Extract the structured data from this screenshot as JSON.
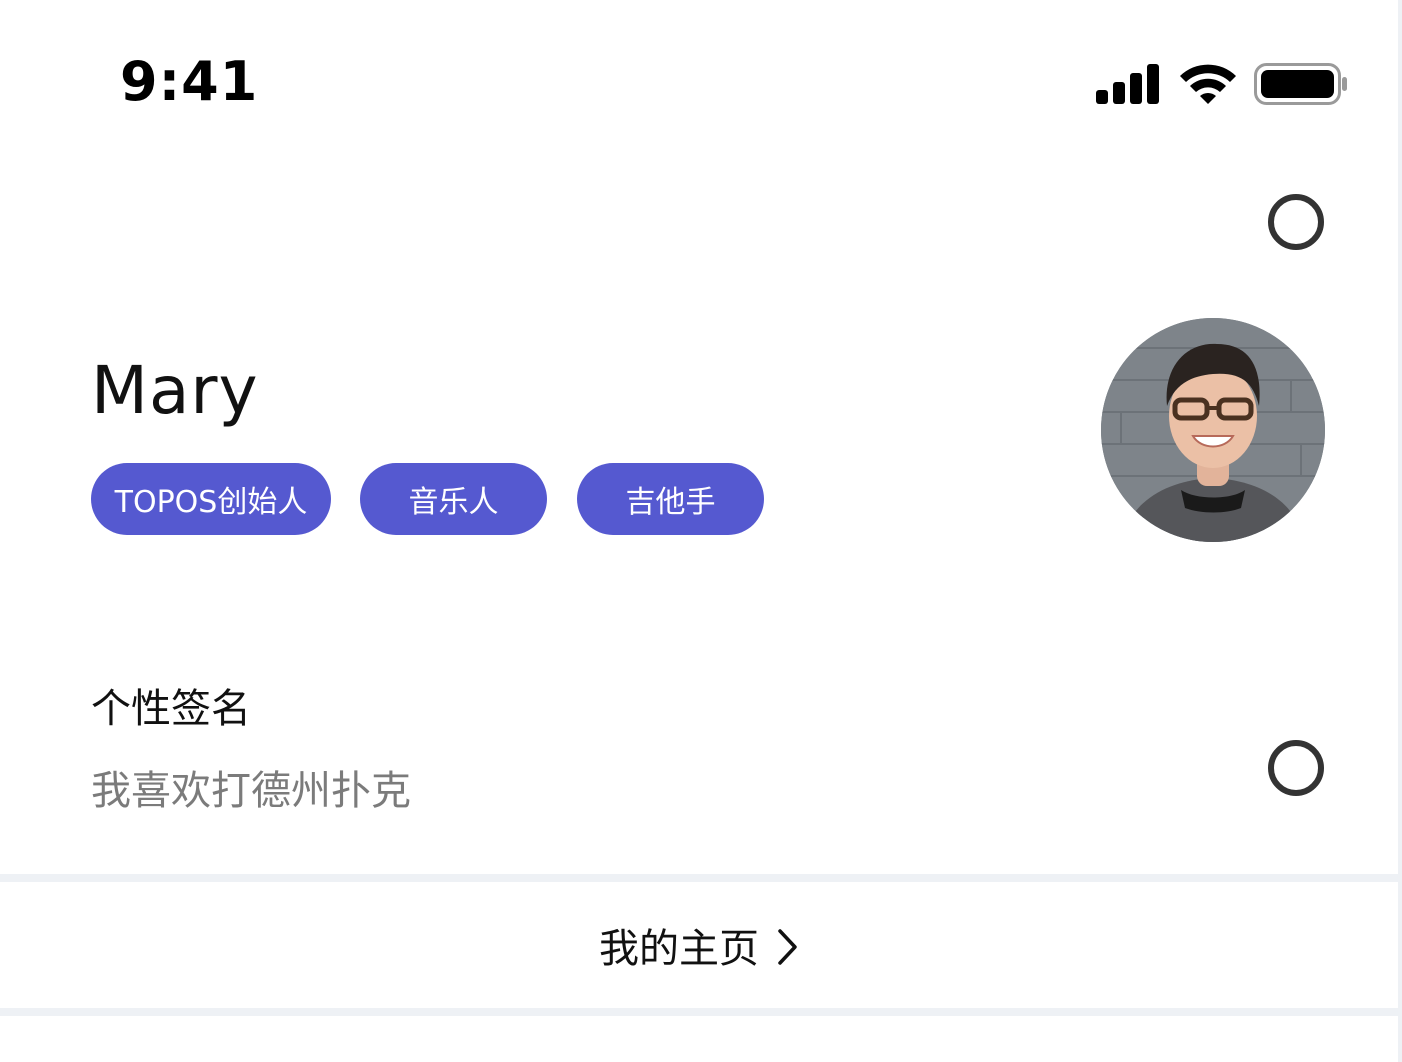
{
  "status_bar": {
    "time": "9:41",
    "icons": [
      "signal-icon",
      "wifi-icon",
      "battery-icon"
    ]
  },
  "profile": {
    "name": "Mary",
    "tags": [
      "TOPOS创始人",
      "音乐人",
      "吉他手"
    ],
    "avatar": "avatar-photo"
  },
  "signature": {
    "title": "个性签名",
    "text": "我喜欢打德州扑克"
  },
  "homepage_link": {
    "label": "我的主页",
    "icon": "chevron-right-icon"
  },
  "colors": {
    "tag_background": "#5559d0",
    "tag_text": "#ffffff",
    "divider": "#eef1f5",
    "secondary_text": "#7b7b7b"
  }
}
